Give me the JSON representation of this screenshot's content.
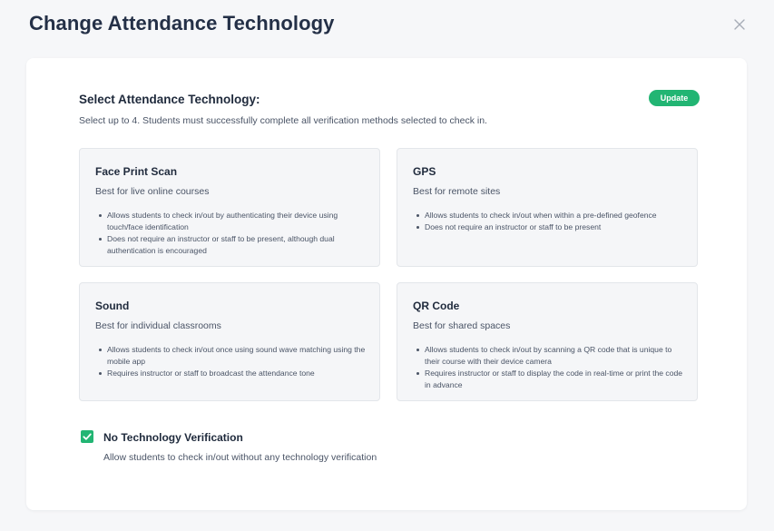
{
  "header": {
    "title": "Change Attendance Technology",
    "close_icon": "close-icon"
  },
  "section": {
    "title": "Select Attendance Technology:",
    "subtitle": "Select up to 4. Students must successfully complete all verification methods selected to check in.",
    "update_label": "Update"
  },
  "colors": {
    "accent": "#22b573",
    "title": "#243047",
    "card_bg": "#f5f6f8"
  },
  "options": [
    {
      "title": "Face Print Scan",
      "subtitle": "Best for live online courses",
      "bullets": [
        "Allows students to check in/out by authenticating their device using touch/face identification",
        "Does not require an instructor or staff to be present, although dual authentication is encouraged"
      ]
    },
    {
      "title": "GPS",
      "subtitle": "Best for remote sites",
      "bullets": [
        "Allows students to check in/out when within a pre-defined geofence",
        "Does not require an instructor or staff to be present"
      ]
    },
    {
      "title": "Sound",
      "subtitle": "Best for individual classrooms",
      "bullets": [
        "Allows students to check in/out once using sound wave matching using the mobile app",
        "Requires instructor or staff to broadcast the attendance tone"
      ]
    },
    {
      "title": "QR Code",
      "subtitle": "Best for shared spaces",
      "bullets": [
        "Allows students to check in/out by scanning a QR code that is unique to their course with their device camera",
        "Requires instructor or staff to display the code in real-time or print the code in advance"
      ]
    }
  ],
  "no_tech": {
    "checked": true,
    "title": "No Technology Verification",
    "subtitle": "Allow students to check in/out without any technology verification",
    "check_icon": "checkmark-icon"
  }
}
